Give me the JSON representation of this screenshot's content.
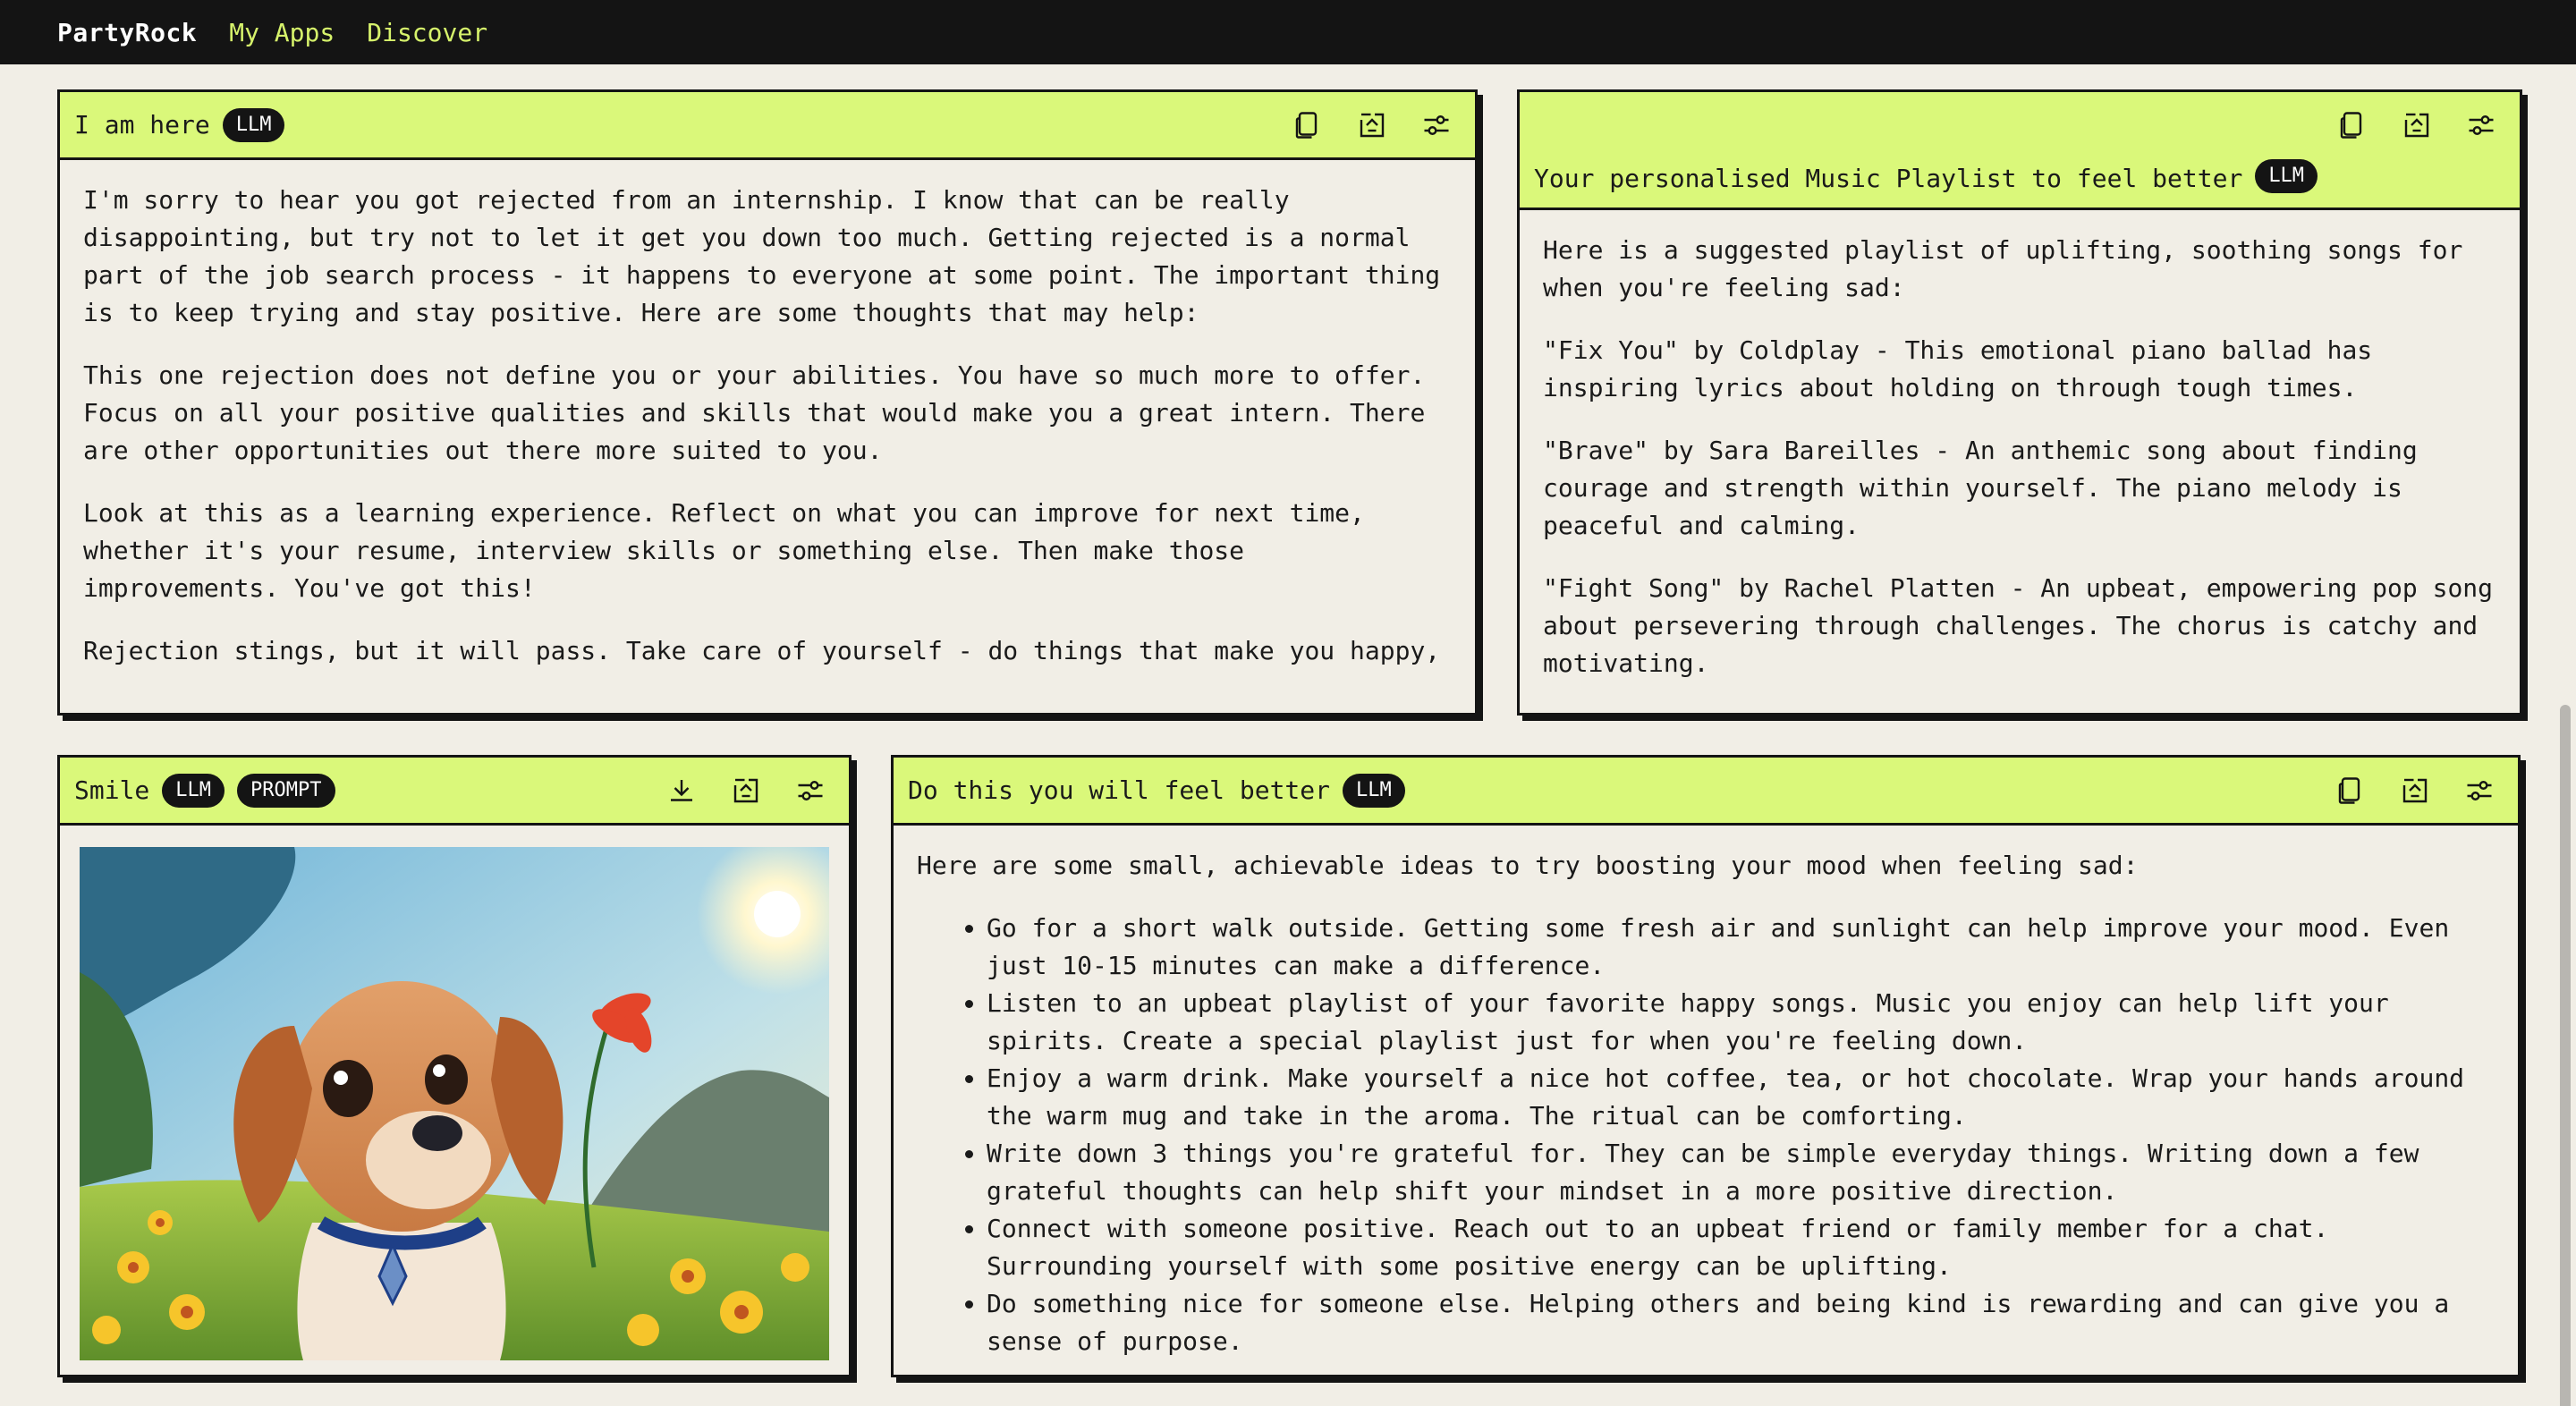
{
  "nav": {
    "brand": "PartyRock",
    "links": [
      "My Apps",
      "Discover"
    ]
  },
  "colors": {
    "accent": "#daf87a",
    "dark": "#141414",
    "background": "#f1eee6",
    "nav_link": "#d6f26b"
  },
  "icons": {
    "copy": "copy-icon",
    "export": "export-icon",
    "settings": "sliders-icon",
    "download": "download-icon"
  },
  "cards": {
    "here": {
      "title": "I am here",
      "badge": "LLM",
      "paragraphs": [
        "I'm sorry to hear you got rejected from an internship. I know that can be really disappointing, but try not to let it get you down too much. Getting rejected is a normal part of the job search process - it happens to everyone at some point. The important thing is to keep trying and stay positive. Here are some thoughts that may help:",
        "This one rejection does not define you or your abilities. You have so much more to offer. Focus on all your positive qualities and skills that would make you a great intern. There are other opportunities out there more suited to you.",
        "Look at this as a learning experience. Reflect on what you can improve for next time, whether it's your resume, interview skills or something else. Then make those improvements. You've got this!",
        "Rejection stings, but it will pass. Take care of yourself - do things that make you happy,"
      ]
    },
    "playlist": {
      "title": "Your personalised Music Playlist to feel better",
      "badge": "LLM",
      "paragraphs": [
        "Here is a suggested playlist of uplifting, soothing songs for when you're feeling sad:",
        "\"Fix You\" by Coldplay - This emotional piano ballad has inspiring lyrics about holding on through tough times.",
        "\"Brave\" by Sara Bareilles - An anthemic song about finding courage and strength within yourself. The piano melody is peaceful and calming.",
        "\"Fight Song\" by Rachel Platten - An upbeat, empowering pop song about persevering through challenges. The chorus is catchy and motivating."
      ]
    },
    "smile": {
      "title": "Smile",
      "badges": [
        "LLM",
        "PROMPT"
      ]
    },
    "better": {
      "title": "Do this you will feel better",
      "badge": "LLM",
      "intro": "Here are some small, achievable ideas to try boosting your mood when feeling sad:",
      "items": [
        "Go for a short walk outside. Getting some fresh air and sunlight can help improve your mood. Even just 10-15 minutes can make a difference.",
        "Listen to an upbeat playlist of your favorite happy songs. Music you enjoy can help lift your spirits. Create a special playlist just for when you're feeling down.",
        "Enjoy a warm drink. Make yourself a nice hot coffee, tea, or hot chocolate. Wrap your hands around the warm mug and take in the aroma. The ritual can be comforting.",
        "Write down 3 things you're grateful for. They can be simple everyday things. Writing down a few grateful thoughts can help shift your mindset in a more positive direction.",
        "Connect with someone positive. Reach out to an upbeat friend or family member for a chat. Surrounding yourself with some positive energy can be uplifting.",
        "Do something nice for someone else. Helping others and being kind is rewarding and can give you a sense of purpose."
      ]
    }
  }
}
